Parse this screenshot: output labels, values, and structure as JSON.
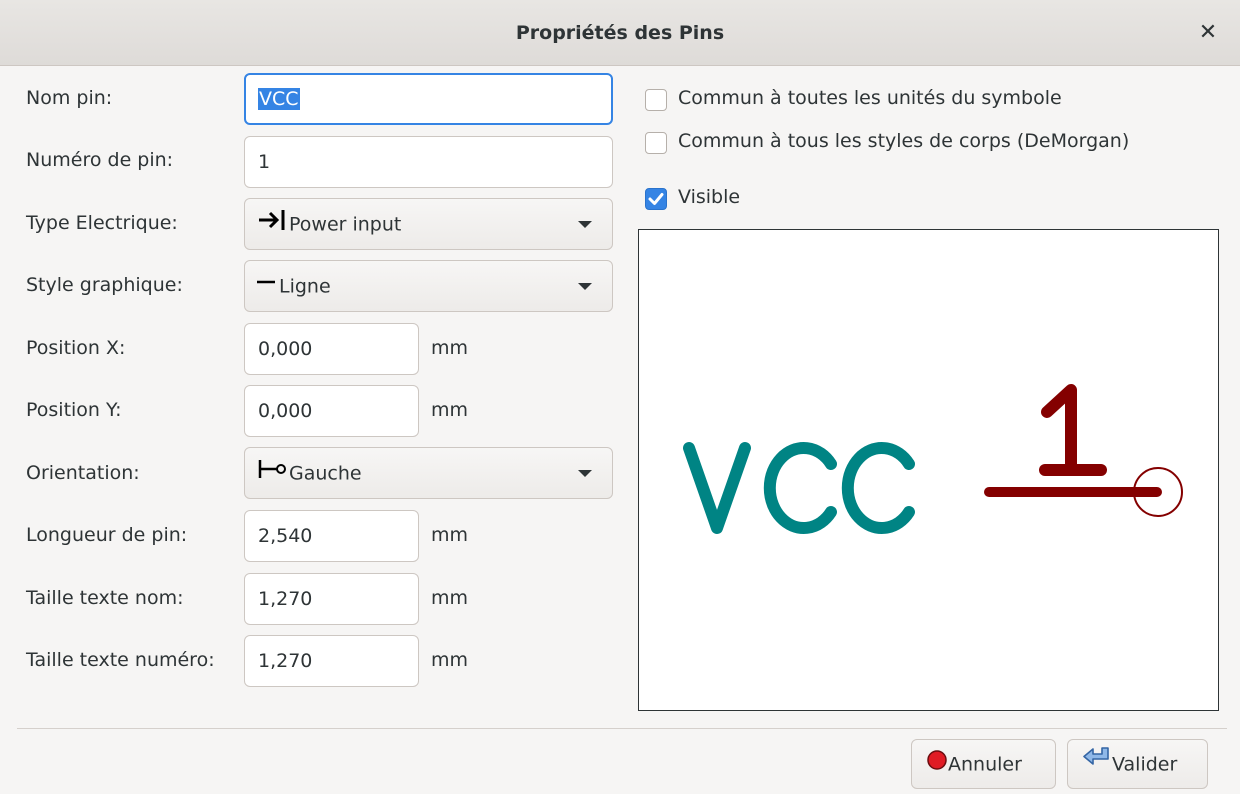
{
  "dialog": {
    "title": "Propriétés des Pins"
  },
  "fields": {
    "pin_name": {
      "label": "Nom pin:",
      "value": "VCC"
    },
    "pin_number": {
      "label": "Numéro de pin:",
      "value": "1"
    },
    "electrical_type": {
      "label": "Type Electrique:",
      "value": "Power input",
      "icon": "power-input-icon"
    },
    "graphic_style": {
      "label": "Style graphique:",
      "value": "Ligne",
      "icon": "line-icon"
    },
    "position_x": {
      "label": "Position X:",
      "value": "0,000",
      "unit": "mm"
    },
    "position_y": {
      "label": "Position Y:",
      "value": "0,000",
      "unit": "mm"
    },
    "orientation": {
      "label": "Orientation:",
      "value": "Gauche",
      "icon": "pin-left-icon"
    },
    "pin_length": {
      "label": "Longueur de pin:",
      "value": "2,540",
      "unit": "mm"
    },
    "name_text_size": {
      "label": "Taille texte nom:",
      "value": "1,270",
      "unit": "mm"
    },
    "number_text_size": {
      "label": "Taille texte numéro:",
      "value": "1,270",
      "unit": "mm"
    }
  },
  "options": {
    "common_units": {
      "label": "Commun à toutes les unités du symbole",
      "checked": false
    },
    "common_body_styles": {
      "label": "Commun à tous les styles de corps  (DeMorgan)",
      "checked": false
    },
    "visible": {
      "label": "Visible",
      "checked": true
    }
  },
  "preview": {
    "pin_name": "VCC",
    "pin_number": "1",
    "name_color": "#008484",
    "pin_color": "#840000"
  },
  "buttons": {
    "cancel": {
      "label": "Annuler",
      "icon": "stop-icon"
    },
    "ok": {
      "label": "Valider",
      "icon": "return-arrow-icon"
    }
  }
}
